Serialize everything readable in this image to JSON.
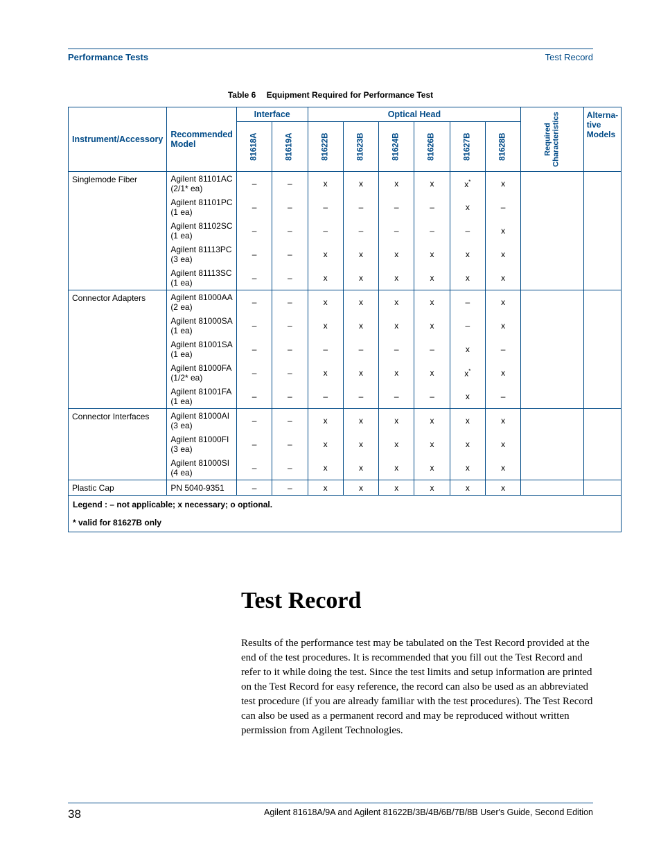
{
  "header": {
    "left": "Performance Tests",
    "right": "Test Record"
  },
  "table": {
    "caption_prefix": "Table 6",
    "caption_text": "Equipment Required for Performance Test",
    "col_instrument": "Instrument/Accessory",
    "col_model": "Recommended Model",
    "group_interface": "Interface",
    "group_optical": "Optical Head",
    "col_81618A": "81618A",
    "col_81619A": "81619A",
    "col_81622B": "81622B",
    "col_81623B": "81623B",
    "col_81624B": "81624B",
    "col_81626B": "81626B",
    "col_81627B": "81627B",
    "col_81628B": "81628B",
    "col_reqchar_l1": "Required",
    "col_reqchar_l2": "Characteristics",
    "col_alt_l1": "Alterna-",
    "col_alt_l2": "tive",
    "col_alt_l3": "Models",
    "groups": [
      {
        "instrument": "Singlemode Fiber",
        "rows": [
          {
            "model": "Agilent 81101AC (2/1* ea)",
            "c": [
              "–",
              "–",
              "x",
              "x",
              "x",
              "x",
              "x*",
              "x",
              "",
              ""
            ]
          },
          {
            "model": "Agilent 81101PC (1 ea)",
            "c": [
              "–",
              "–",
              "–",
              "–",
              "–",
              "–",
              "x",
              "–",
              "",
              ""
            ]
          },
          {
            "model": "Agilent 81102SC (1 ea)",
            "c": [
              "–",
              "–",
              "–",
              "–",
              "–",
              "–",
              "–",
              "x",
              "",
              ""
            ]
          },
          {
            "model": "Agilent 81113PC (3 ea)",
            "c": [
              "–",
              "–",
              "x",
              "x",
              "x",
              "x",
              "x",
              "x",
              "",
              ""
            ]
          },
          {
            "model": "Agilent 81113SC (1 ea)",
            "c": [
              "–",
              "–",
              "x",
              "x",
              "x",
              "x",
              "x",
              "x",
              "",
              ""
            ]
          }
        ]
      },
      {
        "instrument": "Connector Adapters",
        "rows": [
          {
            "model": "Agilent 81000AA  (2 ea)",
            "c": [
              "–",
              "–",
              "x",
              "x",
              "x",
              "x",
              "–",
              "x",
              "",
              ""
            ]
          },
          {
            "model": "Agilent 81000SA  (1 ea)",
            "c": [
              "–",
              "–",
              "x",
              "x",
              "x",
              "x",
              "–",
              "x",
              "",
              ""
            ]
          },
          {
            "model": "Agilent 81001SA (1 ea)",
            "c": [
              "–",
              "–",
              "–",
              "–",
              "–",
              "–",
              "x",
              "–",
              "",
              ""
            ]
          },
          {
            "model": "Agilent 81000FA  (1/2* ea)",
            "c": [
              "–",
              "–",
              "x",
              "x",
              "x",
              "x",
              "x*",
              "x",
              "",
              ""
            ]
          },
          {
            "model": "Agilent 81001FA  (1 ea)",
            "c": [
              "–",
              "–",
              "–",
              "–",
              "–",
              "–",
              "x",
              "–",
              "",
              ""
            ]
          }
        ]
      },
      {
        "instrument": "Connector Interfaces",
        "rows": [
          {
            "model": "Agilent 81000AI (3 ea)",
            "c": [
              "–",
              "–",
              "x",
              "x",
              "x",
              "x",
              "x",
              "x",
              "",
              ""
            ]
          },
          {
            "model": "Agilent 81000FI (3 ea)",
            "c": [
              "–",
              "–",
              "x",
              "x",
              "x",
              "x",
              "x",
              "x",
              "",
              ""
            ]
          },
          {
            "model": "Agilent 81000SI (4 ea)",
            "c": [
              "–",
              "–",
              "x",
              "x",
              "x",
              "x",
              "x",
              "x",
              "",
              ""
            ]
          }
        ]
      },
      {
        "instrument": "Plastic Cap",
        "rows": [
          {
            "model": "PN 5040-9351",
            "c": [
              "–",
              "–",
              "x",
              "x",
              "x",
              "x",
              "x",
              "x",
              "",
              ""
            ]
          }
        ]
      }
    ],
    "legend1": "Legend : – not applicable; x necessary; o optional.",
    "legend2": "* valid for 81627B only"
  },
  "section": {
    "heading": "Test Record",
    "paragraph": "Results of the performance test may be tabulated on the Test Record provided at the end of the test procedures. It is recommended that you fill out the Test Record and refer to it while doing the test. Since the test limits and setup information are printed on the Test Record for easy reference, the record can also be used as an abbreviated test procedure (if you are already familiar with the test procedures). The Test Record can also be used as a permanent record and may be reproduced without written permission from Agilent Technologies."
  },
  "footer": {
    "page": "38",
    "text": "Agilent  81618A/9A and Agilent 81622B/3B/4B/6B/7B/8B User's Guide, Second Edition"
  }
}
